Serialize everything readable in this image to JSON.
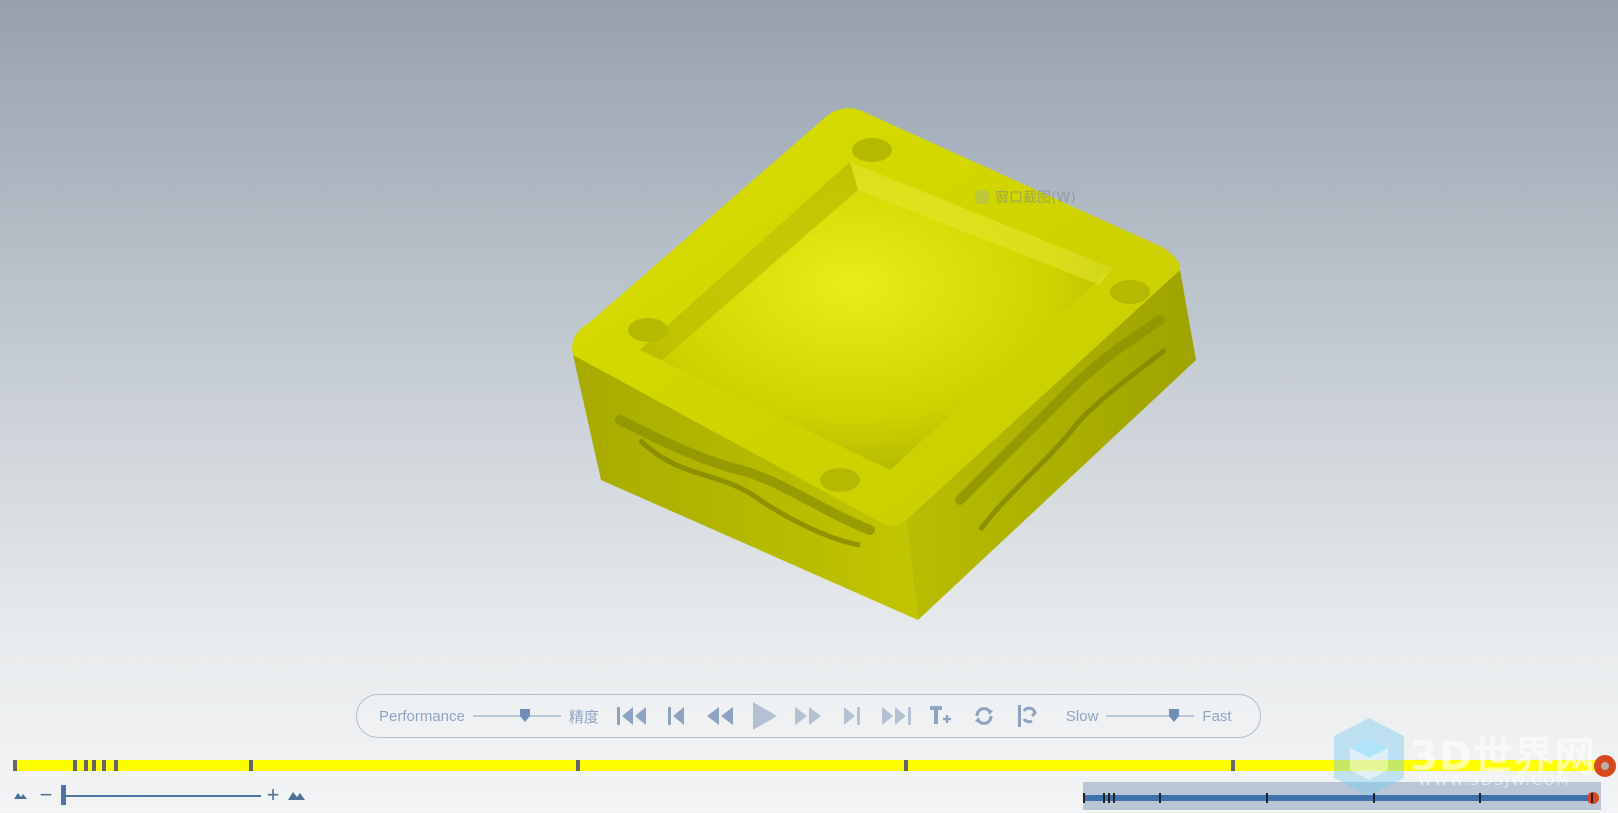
{
  "viewport": {
    "tooltip_text": "窗口截图(W)"
  },
  "controls": {
    "performance_label": "Performance",
    "precision_label": "精度",
    "precision_level": 0.6,
    "slow_label": "Slow",
    "fast_label": "Fast",
    "speed_level": 0.8,
    "accent_color": "#8ea3c2"
  },
  "timeline": {
    "bar_color": "#ffff00",
    "ticks": [
      0.0,
      0.038,
      0.045,
      0.05,
      0.056,
      0.064,
      0.149,
      0.356,
      0.563,
      0.77
    ],
    "end_marker_color": "#d8481e"
  },
  "zoom": {
    "minus_label": "−",
    "plus_label": "+",
    "level": 0.0
  },
  "navigator": {
    "marks": [
      0.0,
      0.04,
      0.05,
      0.06,
      0.15,
      0.36,
      0.57,
      0.78,
      1.0
    ]
  },
  "watermark": {
    "title": "3D世界网",
    "subtitle": "WWW.3DSJW.COM"
  }
}
